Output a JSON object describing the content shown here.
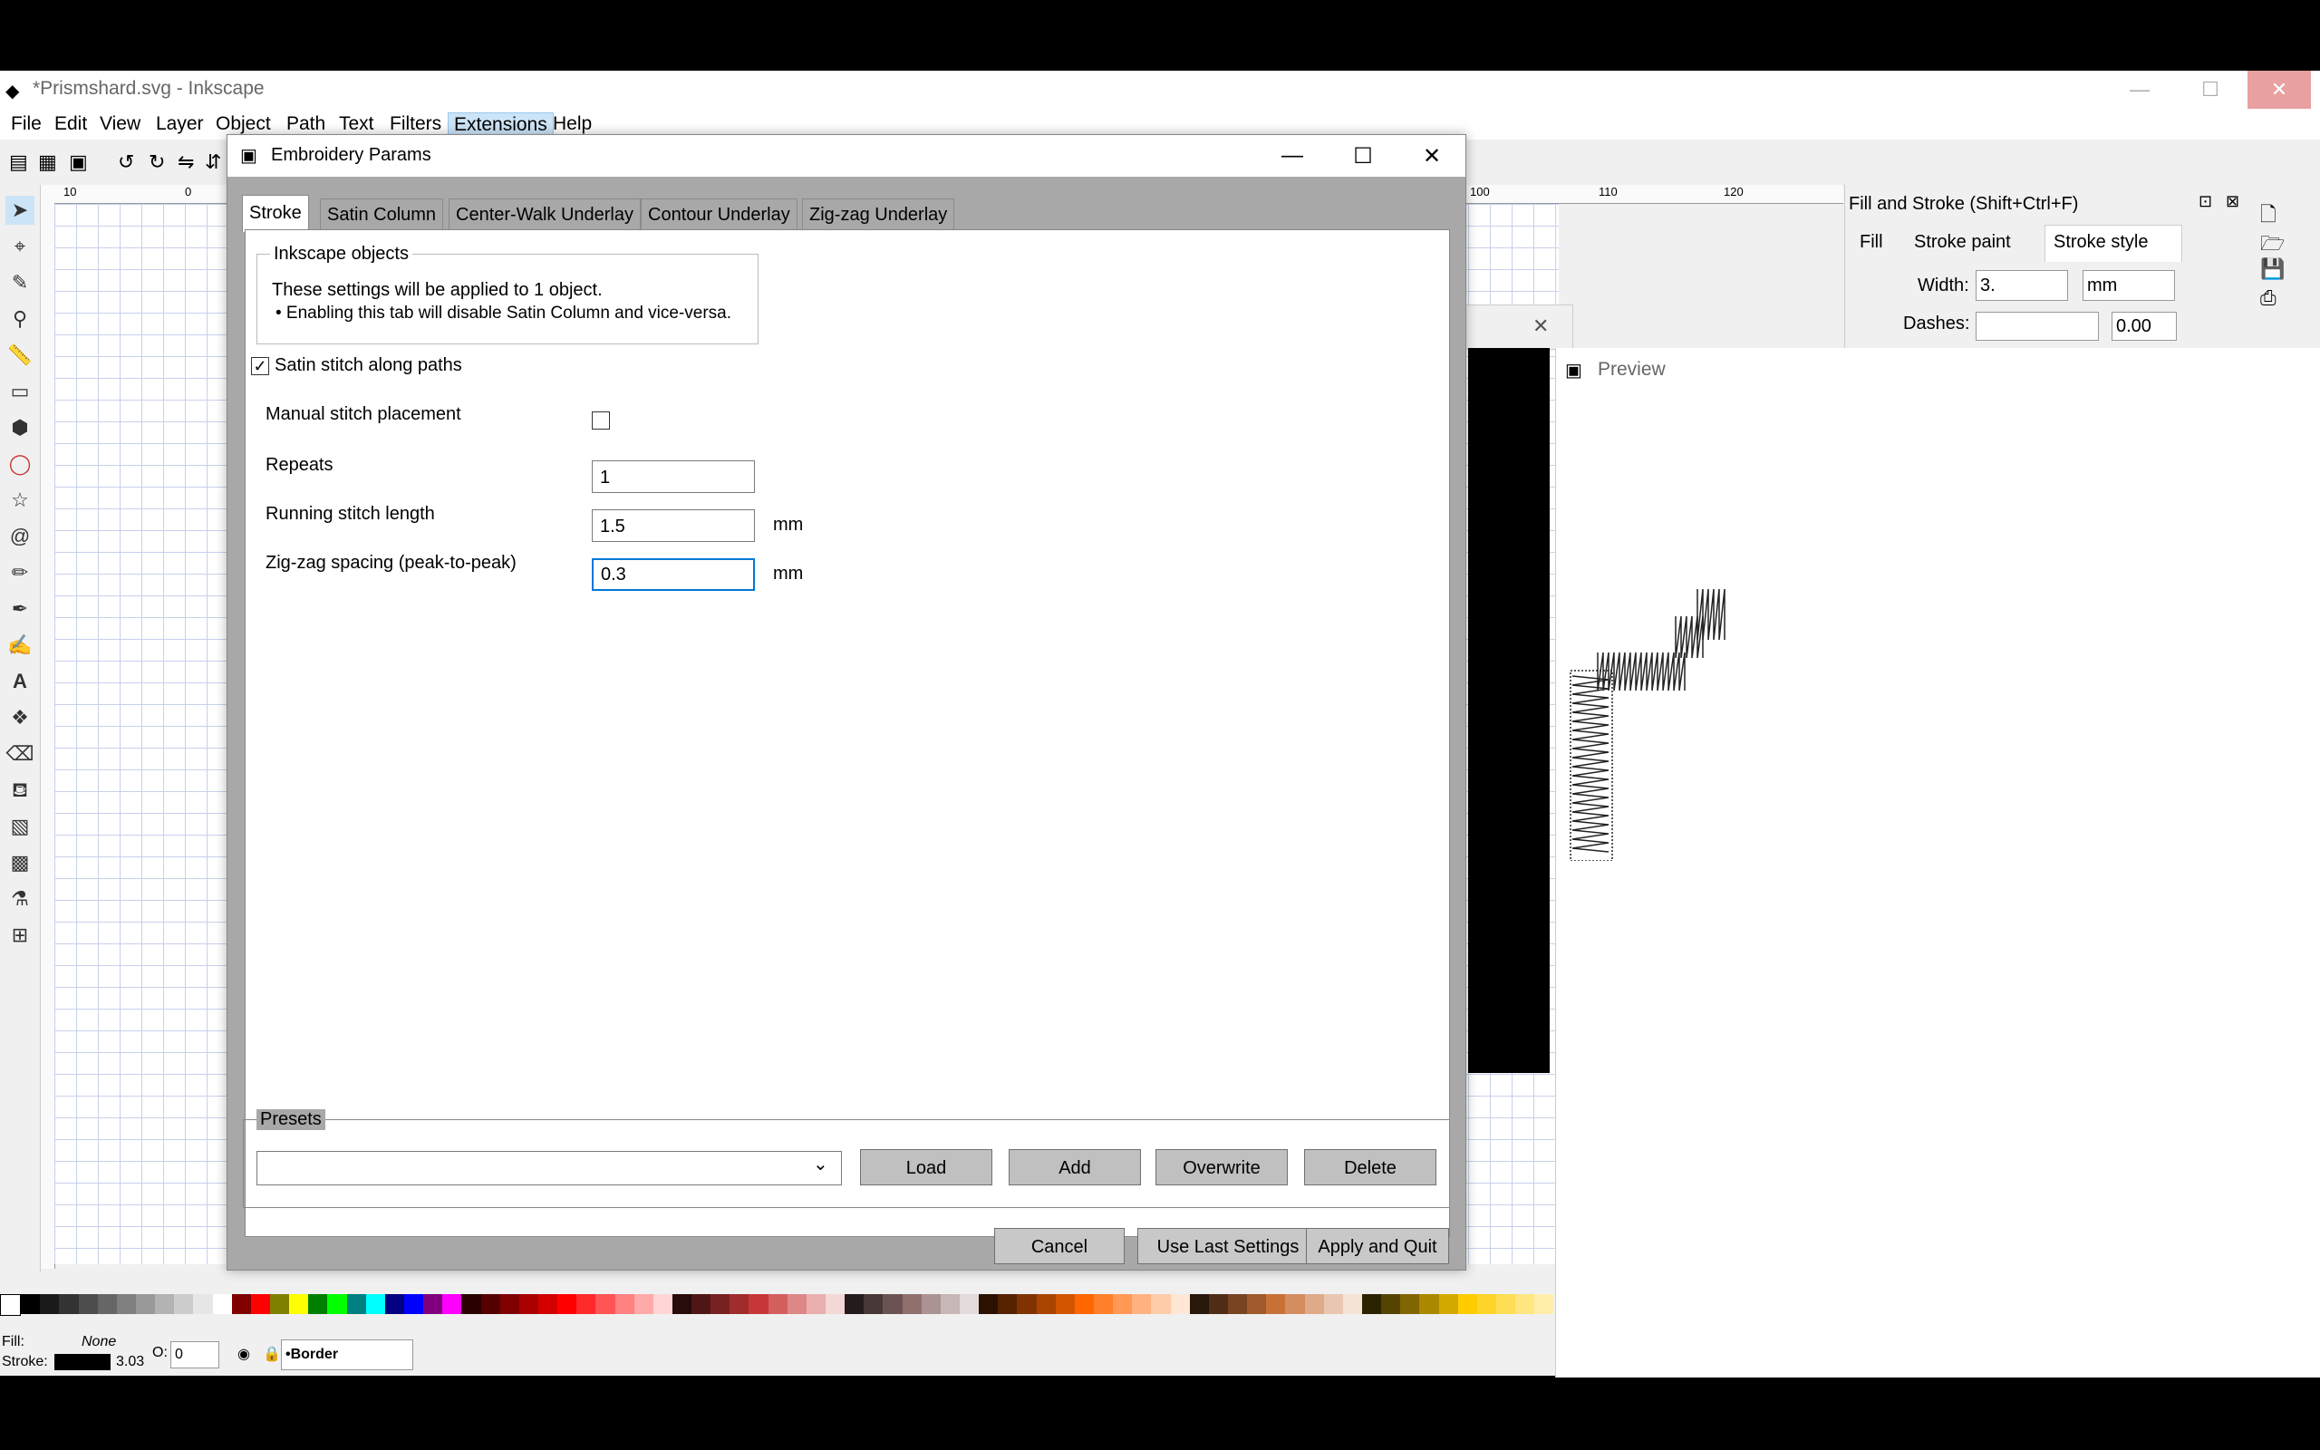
{
  "window": {
    "title": "*Prismshard.svg - Inkscape"
  },
  "menu": [
    "File",
    "Edit",
    "View",
    "Layer",
    "Object",
    "Path",
    "Text",
    "Filters",
    "Extensions",
    "Help"
  ],
  "ruler": {
    "h_ticks": [
      "10",
      "0",
      "100",
      "110",
      "120"
    ]
  },
  "fill_stroke": {
    "title": "Fill and Stroke (Shift+Ctrl+F)",
    "tabs": [
      "Fill",
      "Stroke paint",
      "Stroke style"
    ],
    "width_label": "Width:",
    "width_value": "3.",
    "width_unit": "mm",
    "dashes_label": "Dashes:",
    "dashes_value": "0.00"
  },
  "preview": {
    "title": "Preview"
  },
  "dialog": {
    "title": "Embroidery Params",
    "tabs": [
      "Stroke",
      "Satin Column",
      "Center-Walk Underlay",
      "Contour Underlay",
      "Zig-zag Underlay"
    ],
    "group_title": "Inkscape objects",
    "info_line1": "These settings will be applied to 1 object.",
    "info_line2": "• Enabling this tab will disable Satin Column and vice-versa.",
    "enable_label": "Satin stitch along paths",
    "enable_checked": true,
    "params": [
      {
        "label": "Manual stitch placement",
        "type": "checkbox",
        "checked": false
      },
      {
        "label": "Repeats",
        "type": "text",
        "value": "1",
        "unit": ""
      },
      {
        "label": "Running stitch length",
        "type": "text",
        "value": "1.5",
        "unit": "mm"
      },
      {
        "label": "Zig-zag spacing (peak-to-peak)",
        "type": "text",
        "value": "0.3",
        "unit": "mm"
      }
    ],
    "presets_title": "Presets",
    "preset_value": "",
    "buttons": {
      "load": "Load",
      "add": "Add",
      "overwrite": "Overwrite",
      "delete": "Delete"
    },
    "bottom": {
      "cancel": "Cancel",
      "use_last": "Use Last Settings",
      "apply": "Apply and Quit"
    }
  },
  "status": {
    "fill_label": "Fill:",
    "fill_value": "None",
    "stroke_label": "Stroke:",
    "stroke_width": "3.03",
    "opacity_label": "O:",
    "opacity_value": "0",
    "layer": "•Border"
  },
  "colors": {
    "accent": "#0078d7",
    "menu_active": "#cce4f7"
  }
}
